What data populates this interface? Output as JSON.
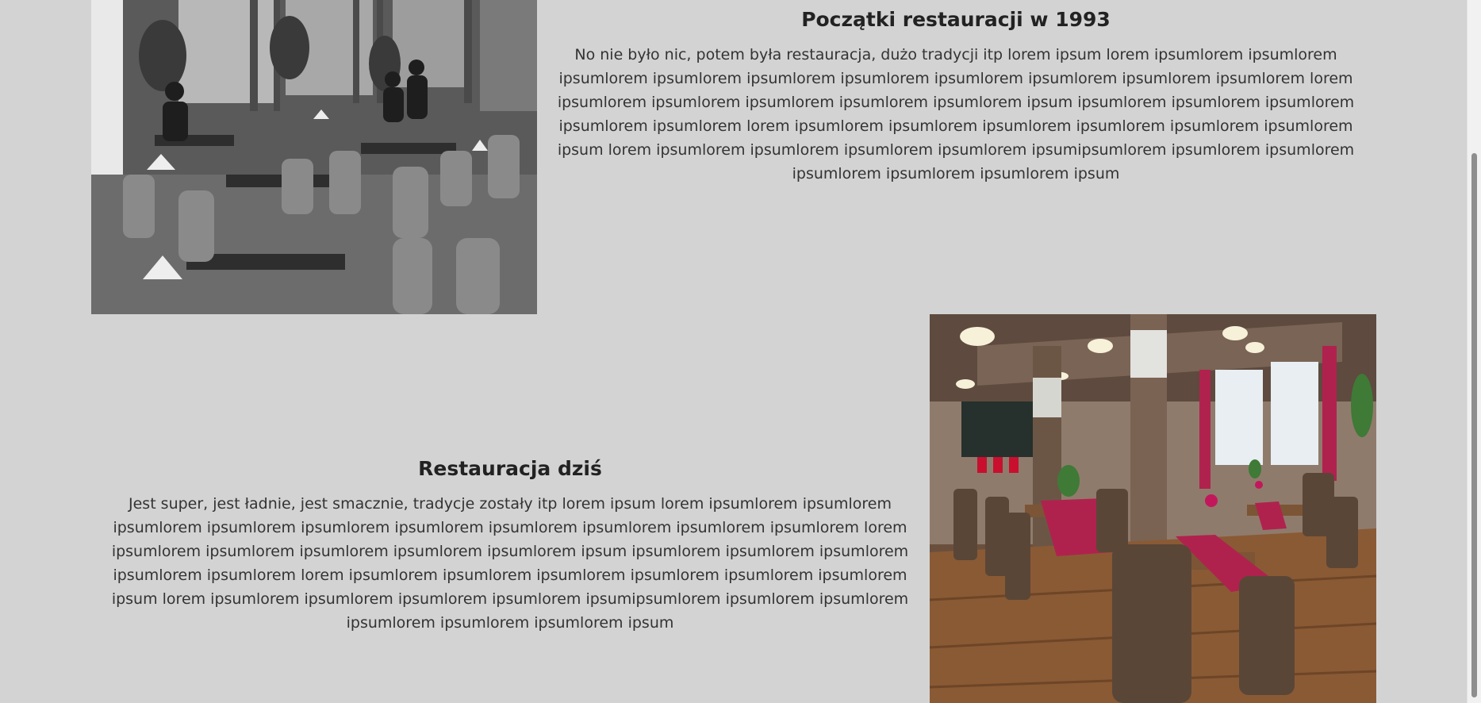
{
  "sections": [
    {
      "title": "Początki restauracji w 1993",
      "text": "No nie było nic, potem była restauracja, dużo tradycji itp lorem ipsum lorem ipsumlorem ipsumlorem ipsumlorem ipsumlorem ipsumlorem ipsumlorem ipsumlorem ipsumlorem ipsumlorem ipsumlorem lorem ipsumlorem ipsumlorem ipsumlorem ipsumlorem ipsumlorem ipsum ipsumlorem ipsumlorem ipsumlorem ipsumlorem ipsumlorem lorem ipsumlorem ipsumlorem ipsumlorem ipsumlorem ipsumlorem ipsumlorem ipsum lorem ipsumlorem ipsumlorem ipsumlorem ipsumlorem ipsumipsumlorem ipsumlorem ipsumlorem ipsumlorem ipsumlorem ipsumlorem ipsum",
      "image": "historic-restaurant-photo"
    },
    {
      "title": "Restauracja dziś",
      "text": "Jest super, jest ładnie, jest smacznie, tradycje zostały itp lorem ipsum lorem ipsumlorem ipsumlorem ipsumlorem ipsumlorem ipsumlorem ipsumlorem ipsumlorem ipsumlorem ipsumlorem ipsumlorem lorem ipsumlorem ipsumlorem ipsumlorem ipsumlorem ipsumlorem ipsum ipsumlorem ipsumlorem ipsumlorem ipsumlorem ipsumlorem lorem ipsumlorem ipsumlorem ipsumlorem ipsumlorem ipsumlorem ipsumlorem ipsum lorem ipsumlorem ipsumlorem ipsumlorem ipsumlorem ipsumipsumlorem ipsumlorem ipsumlorem ipsumlorem ipsumlorem ipsumlorem ipsum",
      "image": "modern-restaurant-photo"
    }
  ],
  "colors": {
    "background": "#d3d3d3",
    "text": "#2b2b2b",
    "accent_tablecloth": "#b0224e"
  }
}
